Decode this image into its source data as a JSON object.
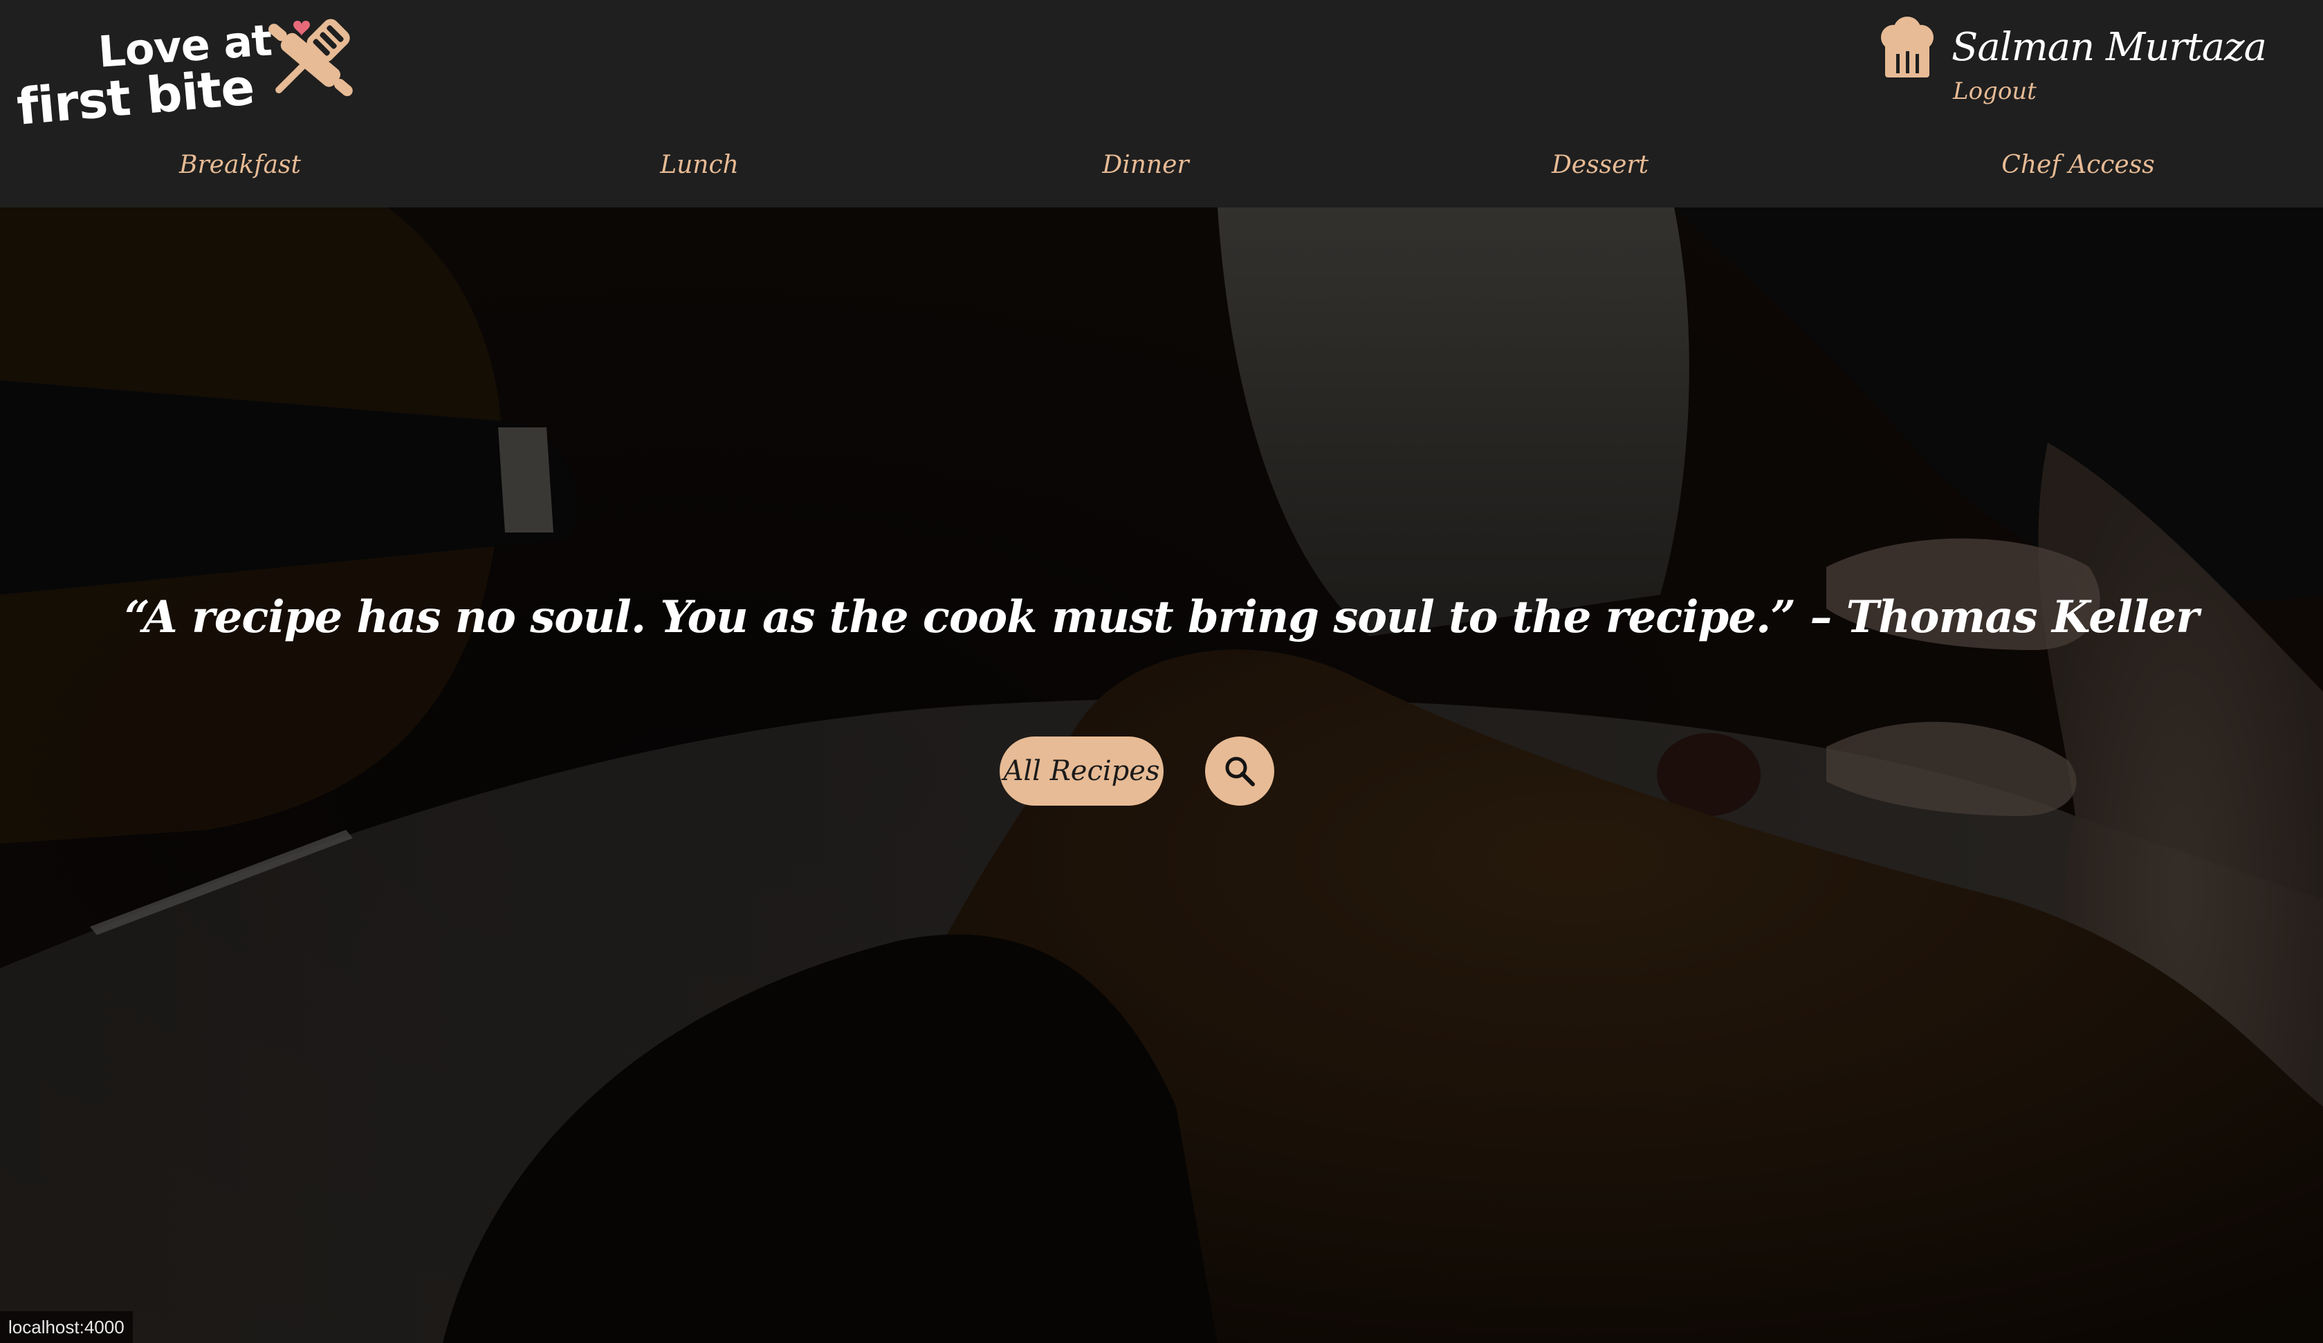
{
  "logo": {
    "line1": "Love at",
    "line2": "first bite"
  },
  "user": {
    "name": "Salman Murtaza",
    "logout_label": "Logout"
  },
  "nav": {
    "items": [
      {
        "label": "Breakfast"
      },
      {
        "label": "Lunch"
      },
      {
        "label": "Dinner"
      },
      {
        "label": "Dessert"
      },
      {
        "label": "Chef Access"
      }
    ]
  },
  "hero": {
    "quote": "“A recipe has no soul. You as the cook must bring soul to the recipe.” – Thomas Keller",
    "all_recipes_label": "All Recipes",
    "search_icon": "search-icon"
  },
  "status_bar": {
    "url": "localhost:4000"
  },
  "colors": {
    "accent": "#e7bb95",
    "header_bg": "#1f1f1f",
    "text_light": "#ffffff",
    "heart": "#e86a7a"
  }
}
